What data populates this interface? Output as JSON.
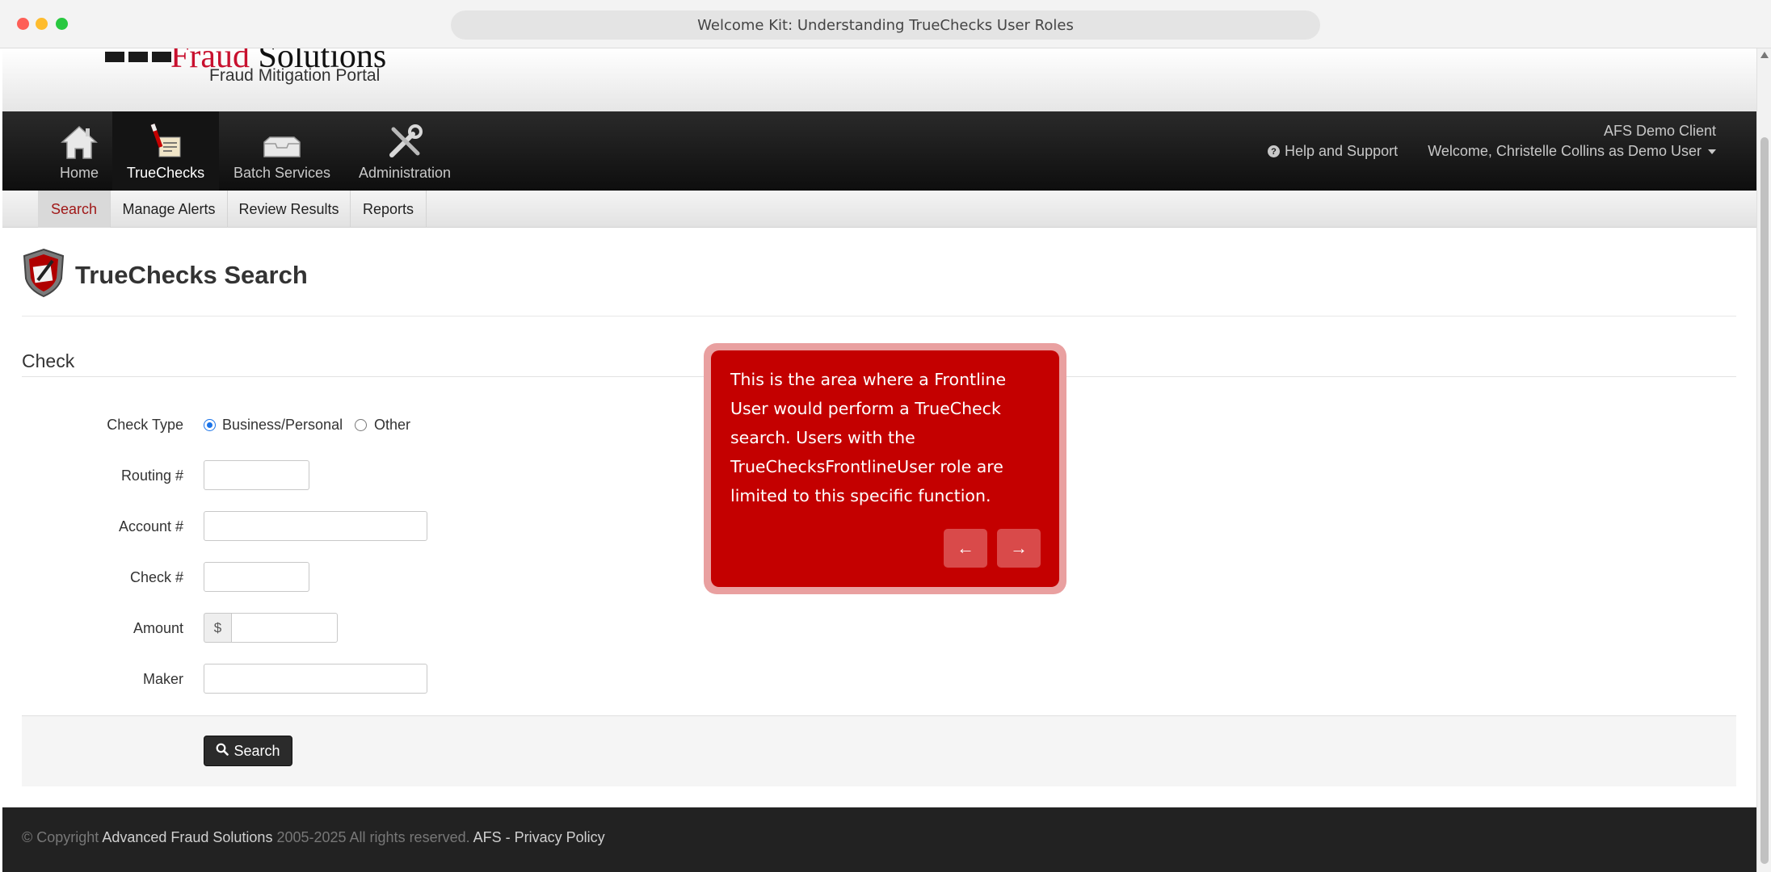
{
  "browser": {
    "title": "Welcome Kit: Understanding TrueChecks User Roles"
  },
  "header": {
    "logo_text_red": "Fraud",
    "logo_text_dark": " Solutions",
    "logo_subtitle": "Fraud Mitigation Portal"
  },
  "mainnav": {
    "items": [
      {
        "label": "Home",
        "icon": "home-icon"
      },
      {
        "label": "TrueChecks",
        "icon": "truechecks-icon"
      },
      {
        "label": "Batch Services",
        "icon": "tray-icon"
      },
      {
        "label": "Administration",
        "icon": "tools-icon"
      }
    ],
    "active": "TrueChecks",
    "client": "AFS Demo Client",
    "help": "Help and Support",
    "user": "Welcome, Christelle Collins as Demo User"
  },
  "subnav": {
    "items": [
      "Search",
      "Manage Alerts",
      "Review Results",
      "Reports"
    ],
    "active": "Search"
  },
  "page": {
    "title": "TrueChecks Search",
    "section": "Check"
  },
  "form": {
    "check_type_label": "Check Type",
    "check_type_options": [
      "Business/Personal",
      "Other"
    ],
    "check_type_selected": "Business/Personal",
    "routing_label": "Routing #",
    "routing_value": "",
    "account_label": "Account #",
    "account_value": "",
    "check_label": "Check #",
    "check_value": "",
    "amount_label": "Amount",
    "amount_prefix": "$",
    "amount_value": "",
    "maker_label": "Maker",
    "maker_value": "",
    "search_button": "Search"
  },
  "footer": {
    "copyright_prefix": "© Copyright ",
    "company_link": "Advanced Fraud Solutions",
    "copyright_suffix": " 2005-2025 All rights reserved. ",
    "afs_link": "AFS",
    "separator": " - ",
    "privacy_link": "Privacy Policy"
  },
  "tour": {
    "text": "This is the area where a Frontline User would perform a TrueCheck search. Users with the TrueChecksFrontlineUser role are limited to this specific function.",
    "prev_symbol": "←",
    "next_symbol": "→"
  },
  "colors": {
    "accent_red": "#c40000",
    "nav_dark": "#141414",
    "active_subtab_text": "#a01818"
  }
}
